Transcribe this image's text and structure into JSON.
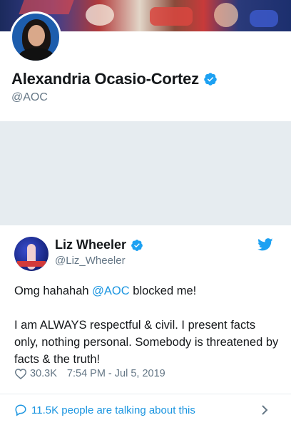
{
  "profile": {
    "name": "Alexandria Ocasio-Cortez",
    "handle": "@AOC"
  },
  "tweet": {
    "author_name": "Liz Wheeler",
    "author_handle": "@Liz_Wheeler",
    "text_before_mention": "Omg hahahah ",
    "mention": "@AOC",
    "text_after_mention": " blocked me!",
    "paragraph_2": "I am ALWAYS respectful & civil. I present facts only, nothing personal. Somebody is threatened by facts & the truth!",
    "likes": "30.3K",
    "timestamp": "7:54 PM - Jul 5, 2019"
  },
  "footer": {
    "talking_label": "11.5K people are talking about this"
  },
  "icons": {
    "verified": "verified-badge-icon",
    "bird": "twitter-bird-icon",
    "heart": "heart-icon",
    "bubble": "speech-bubble-icon",
    "chevron": "chevron-right-icon"
  },
  "colors": {
    "accent": "#1da1f2",
    "link": "#1b95e0",
    "muted": "#657786",
    "background_gray": "#e6ecf0"
  }
}
